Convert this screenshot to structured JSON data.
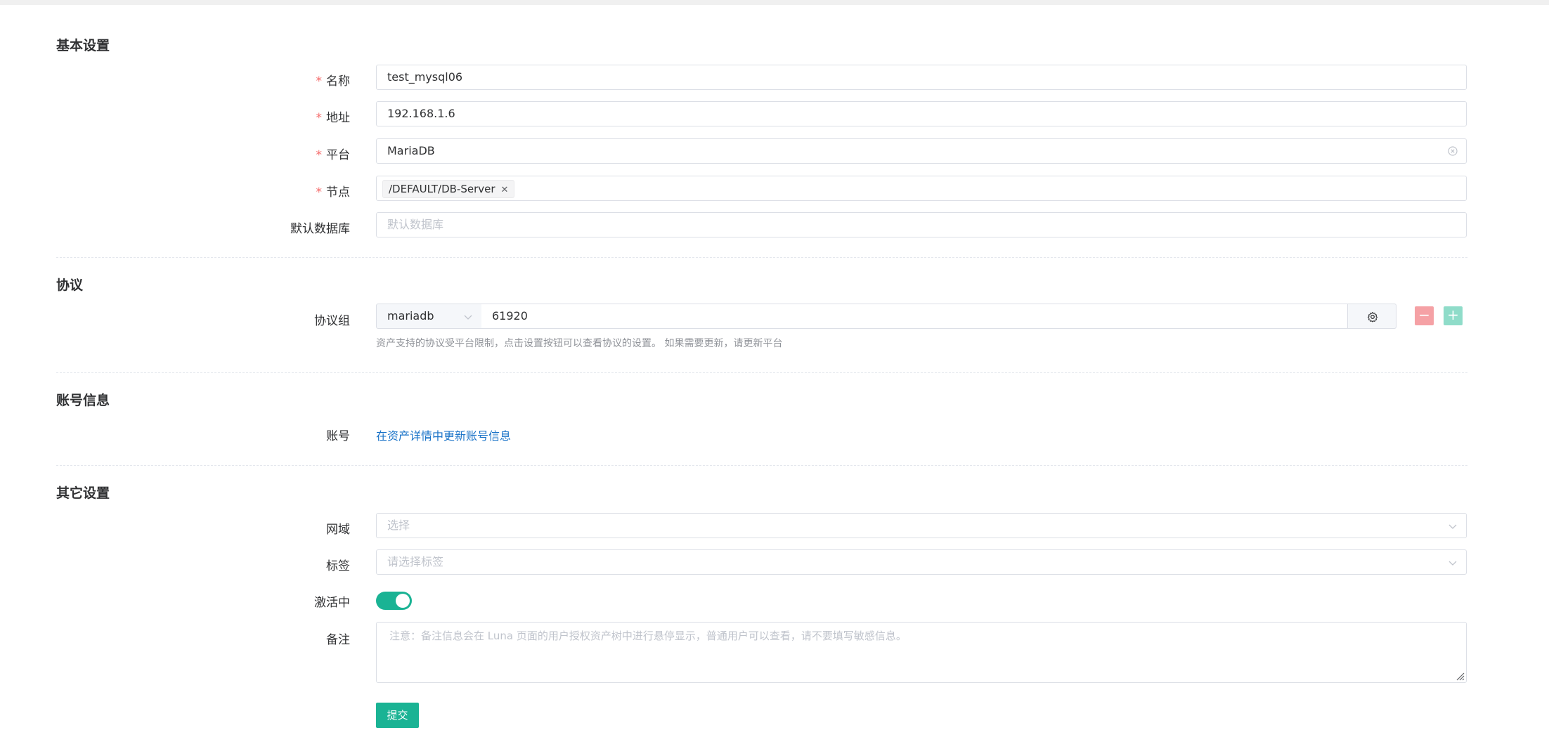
{
  "sections": {
    "basic": "基本设置",
    "protocol": "协议",
    "account": "账号信息",
    "other": "其它设置"
  },
  "fields": {
    "name": {
      "label": "名称",
      "value": "test_mysql06"
    },
    "address": {
      "label": "地址",
      "value": "192.168.1.6"
    },
    "platform": {
      "label": "平台",
      "value": "MariaDB"
    },
    "node": {
      "label": "节点",
      "tag": "/DEFAULT/DB-Server"
    },
    "default_db": {
      "label": "默认数据库",
      "placeholder": "默认数据库"
    },
    "protocol_group": {
      "label": "协议组",
      "protocol": "mariadb",
      "port": "61920",
      "help": "资产支持的协议受平台限制，点击设置按钮可以查看协议的设置。 如果需要更新，请更新平台"
    },
    "account": {
      "label": "账号",
      "link": "在资产详情中更新账号信息"
    },
    "domain": {
      "label": "网域",
      "placeholder": "选择"
    },
    "labels": {
      "label": "标签",
      "placeholder": "请选择标签"
    },
    "active": {
      "label": "激活中",
      "on": true
    },
    "comment": {
      "label": "备注",
      "placeholder": "注意：备注信息会在 Luna 页面的用户授权资产树中进行悬停显示，普通用户可以查看，请不要填写敏感信息。"
    }
  },
  "buttons": {
    "submit": "提交",
    "remove": "−",
    "add": "+"
  },
  "required_mark": "*",
  "colors": {
    "primary": "#1ab394",
    "danger": "#f56c6c",
    "link": "#1a73c8"
  }
}
